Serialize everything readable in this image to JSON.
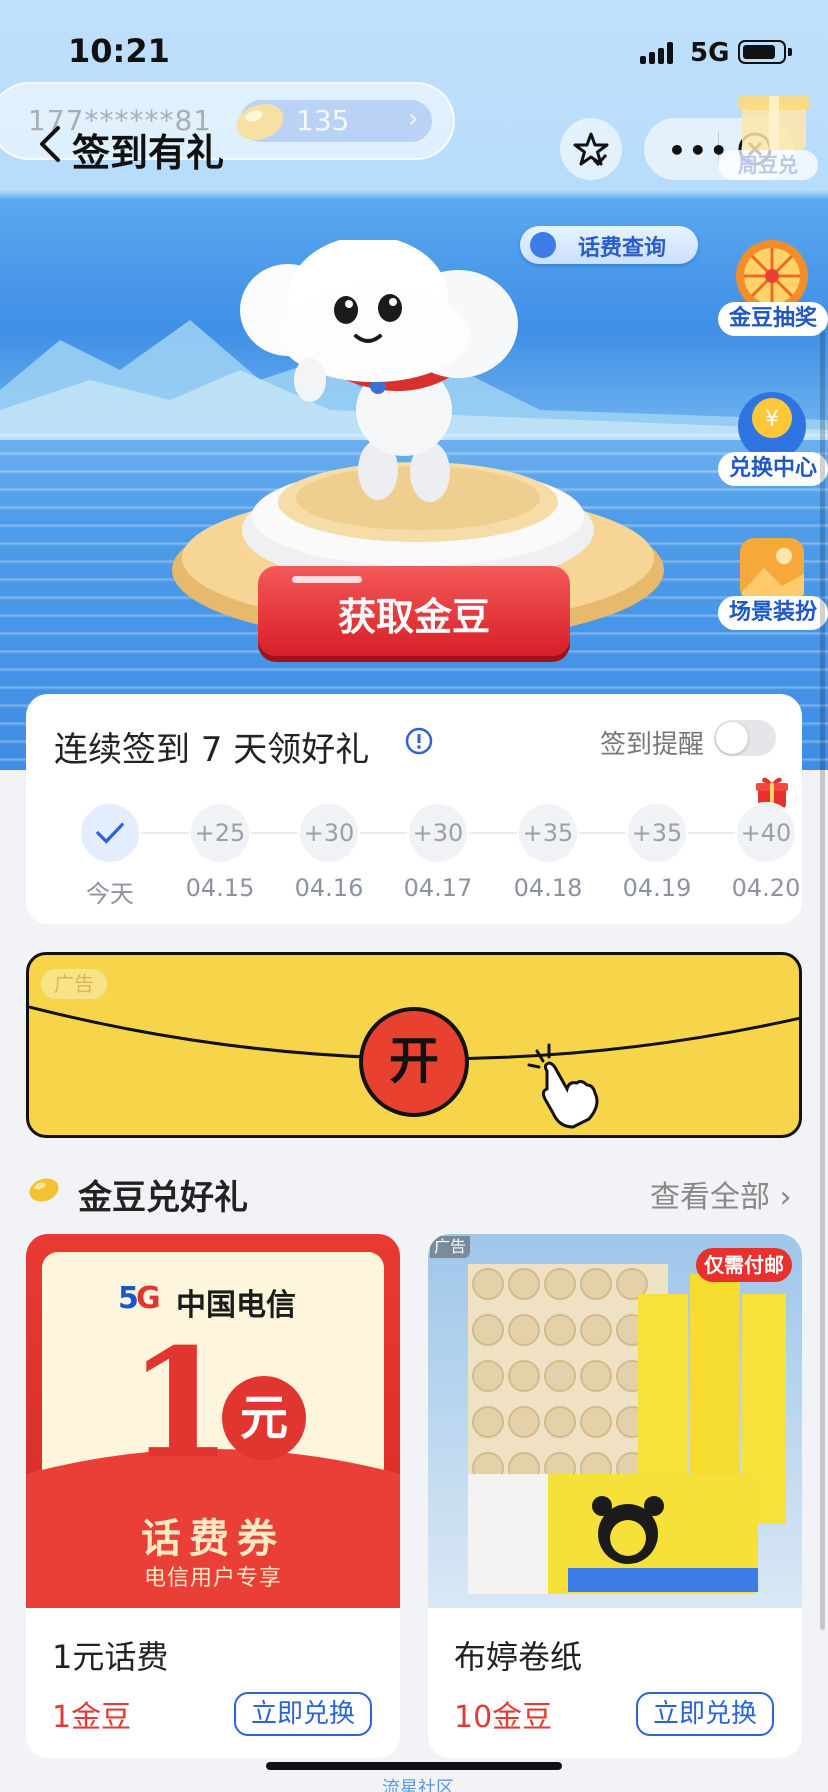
{
  "status_bar": {
    "time": "10:21",
    "network": "5G"
  },
  "account": {
    "number": "177******81",
    "bean_count": "135"
  },
  "header": {
    "title": "签到有礼",
    "gift_label": "周豆兑"
  },
  "hero": {
    "bill_query": "话费查询",
    "get_bean_button": "获取金豆",
    "side_menu": [
      {
        "label": "金豆抽奖",
        "icon": "prize-wheel-icon"
      },
      {
        "label": "兑换中心",
        "icon": "exchange-coin-icon"
      },
      {
        "label": "场景装扮",
        "icon": "scene-dress-icon"
      }
    ]
  },
  "signin": {
    "title": "连续签到 7 天领好礼",
    "reminder_label": "签到提醒",
    "reminder_on": false,
    "days": [
      {
        "reward": "✓",
        "date": "今天",
        "checked": true
      },
      {
        "reward": "+25",
        "date": "04.15"
      },
      {
        "reward": "+30",
        "date": "04.16"
      },
      {
        "reward": "+30",
        "date": "04.17"
      },
      {
        "reward": "+35",
        "date": "04.18"
      },
      {
        "reward": "+35",
        "date": "04.19"
      },
      {
        "reward": "+40",
        "date": "04.20"
      }
    ]
  },
  "ad_banner": {
    "tag": "广告",
    "open_label": "开"
  },
  "section": {
    "title": "金豆兑好礼",
    "view_all": "查看全部 ›"
  },
  "products": [
    {
      "name": "1元话费",
      "price": "1金豆",
      "redeem": "立即兑换",
      "coupon": {
        "brand": "中国电信",
        "amount": "1",
        "unit": "元",
        "title": "话费券",
        "subtitle": "电信用户专享"
      }
    },
    {
      "name": "布婷卷纸",
      "price": "10金豆",
      "redeem": "立即兑换",
      "ad_tag": "广告",
      "cod_tag": "仅需付邮"
    }
  ],
  "watermark": "流星社区",
  "colors": {
    "accent_red": "#e23b35",
    "link_blue": "#2d63d6",
    "hero_blue": "#3f8fe6",
    "banner_yellow": "#f6d54a"
  }
}
